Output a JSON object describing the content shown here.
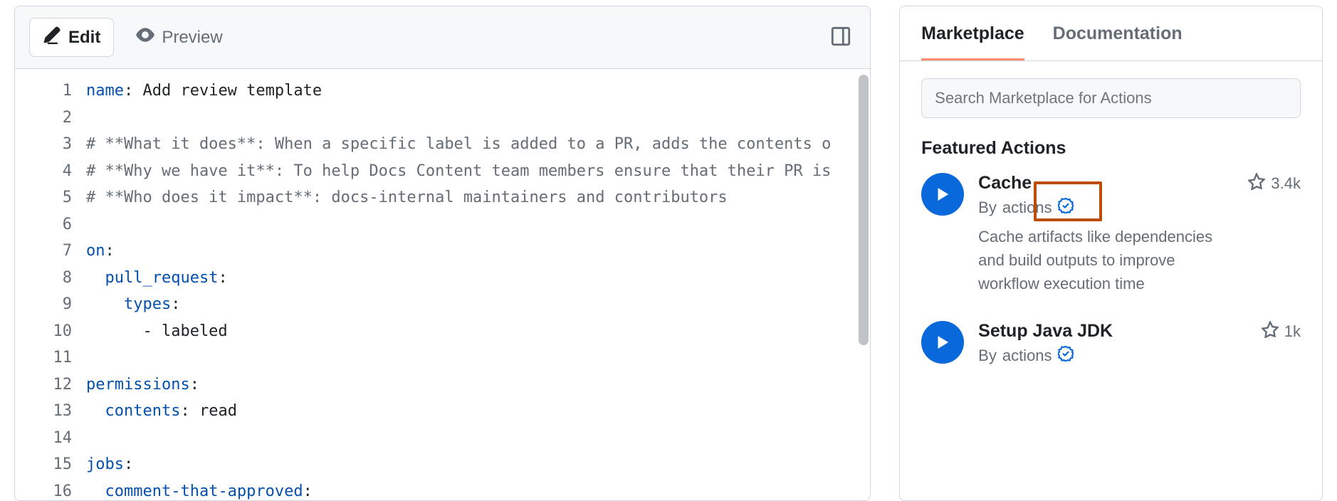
{
  "editor": {
    "tabs": {
      "edit": "Edit",
      "preview": "Preview"
    },
    "lines": [
      {
        "n": 1,
        "segs": [
          [
            "key",
            "name"
          ],
          [
            "punc",
            ":"
          ],
          [
            "str",
            " Add review template"
          ]
        ]
      },
      {
        "n": 2,
        "segs": []
      },
      {
        "n": 3,
        "segs": [
          [
            "cmt",
            "# **What it does**: When a specific label is added to a PR, adds the contents o"
          ]
        ]
      },
      {
        "n": 4,
        "segs": [
          [
            "cmt",
            "# **Why we have it**: To help Docs Content team members ensure that their PR is"
          ]
        ]
      },
      {
        "n": 5,
        "segs": [
          [
            "cmt",
            "# **Who does it impact**: docs-internal maintainers and contributors"
          ]
        ]
      },
      {
        "n": 6,
        "segs": []
      },
      {
        "n": 7,
        "segs": [
          [
            "key",
            "on"
          ],
          [
            "punc",
            ":"
          ]
        ]
      },
      {
        "n": 8,
        "segs": [
          [
            "str",
            "  "
          ],
          [
            "key",
            "pull_request"
          ],
          [
            "punc",
            ":"
          ]
        ]
      },
      {
        "n": 9,
        "segs": [
          [
            "str",
            "    "
          ],
          [
            "key",
            "types"
          ],
          [
            "punc",
            ":"
          ]
        ]
      },
      {
        "n": 10,
        "segs": [
          [
            "str",
            "      - labeled"
          ]
        ]
      },
      {
        "n": 11,
        "segs": []
      },
      {
        "n": 12,
        "segs": [
          [
            "key",
            "permissions"
          ],
          [
            "punc",
            ":"
          ]
        ]
      },
      {
        "n": 13,
        "segs": [
          [
            "str",
            "  "
          ],
          [
            "key",
            "contents"
          ],
          [
            "punc",
            ":"
          ],
          [
            "str",
            " read"
          ]
        ]
      },
      {
        "n": 14,
        "segs": []
      },
      {
        "n": 15,
        "segs": [
          [
            "key",
            "jobs"
          ],
          [
            "punc",
            ":"
          ]
        ]
      },
      {
        "n": 16,
        "segs": [
          [
            "str",
            "  "
          ],
          [
            "key",
            "comment-that-approved"
          ],
          [
            "punc",
            ":"
          ]
        ]
      }
    ]
  },
  "sidebar": {
    "tabs": {
      "marketplace": "Marketplace",
      "documentation": "Documentation"
    },
    "search_placeholder": "Search Marketplace for Actions",
    "featured_title": "Featured Actions",
    "actions": [
      {
        "title": "Cache",
        "by_prefix": "By ",
        "by": "actions",
        "stars": "3.4k",
        "desc": "Cache artifacts like dependencies and build outputs to improve workflow execution time"
      },
      {
        "title": "Setup Java JDK",
        "by_prefix": "By ",
        "by": "actions",
        "stars": "1k",
        "desc": ""
      }
    ]
  }
}
